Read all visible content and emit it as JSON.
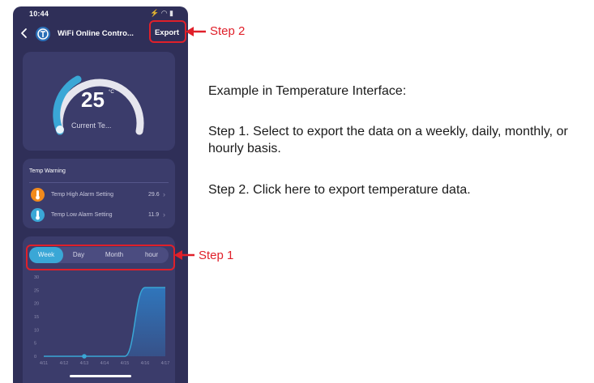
{
  "status_bar": {
    "time": "10:44",
    "icons": "⚡ ◠ ▮"
  },
  "header": {
    "title": "WiFi Online Contro...",
    "export_label": "Export"
  },
  "temperature": {
    "value": "25",
    "unit": "°C",
    "label": "Current Te..."
  },
  "warnings": {
    "title": "Temp Warning",
    "items": [
      {
        "label": "Temp High Alarm Setting",
        "value": "29.6",
        "icon": "thermometer-high-icon",
        "color": "#f28a1c"
      },
      {
        "label": "Temp Low Alarm Setting",
        "value": "11.9",
        "icon": "thermometer-low-icon",
        "color": "#3aa7d6"
      }
    ]
  },
  "period_tabs": {
    "items": [
      "Week",
      "Day",
      "Month",
      "hour"
    ],
    "selected": "Week"
  },
  "chart_data": {
    "type": "area",
    "x": [
      "4/11",
      "4/12",
      "4/13",
      "4/14",
      "4/15",
      "4/16",
      "4/17"
    ],
    "y_ticks": [
      "0",
      "5",
      "10",
      "15",
      "20",
      "25",
      "30"
    ],
    "ylim": [
      0,
      30
    ],
    "series": [
      {
        "values": [
          0,
          0,
          0,
          0,
          0,
          26,
          26
        ]
      }
    ],
    "highlighted_point": "4/13",
    "colors": {
      "line": "#3aa7d6",
      "fill": "#2f79c0"
    }
  },
  "annotations": {
    "step1": "Step 1",
    "step2": "Step 2",
    "color": "#e0202a"
  },
  "instructions": {
    "heading": "Example in Temperature Interface:",
    "step1": "Step 1. Select to export the data on a weekly, daily, monthly, or hourly basis.",
    "step2": "Step 2. Click here to export temperature data."
  },
  "colors": {
    "phone_background": "#2f2f58",
    "card_background": "#3b3c6b",
    "accent": "#3aa7d6"
  }
}
